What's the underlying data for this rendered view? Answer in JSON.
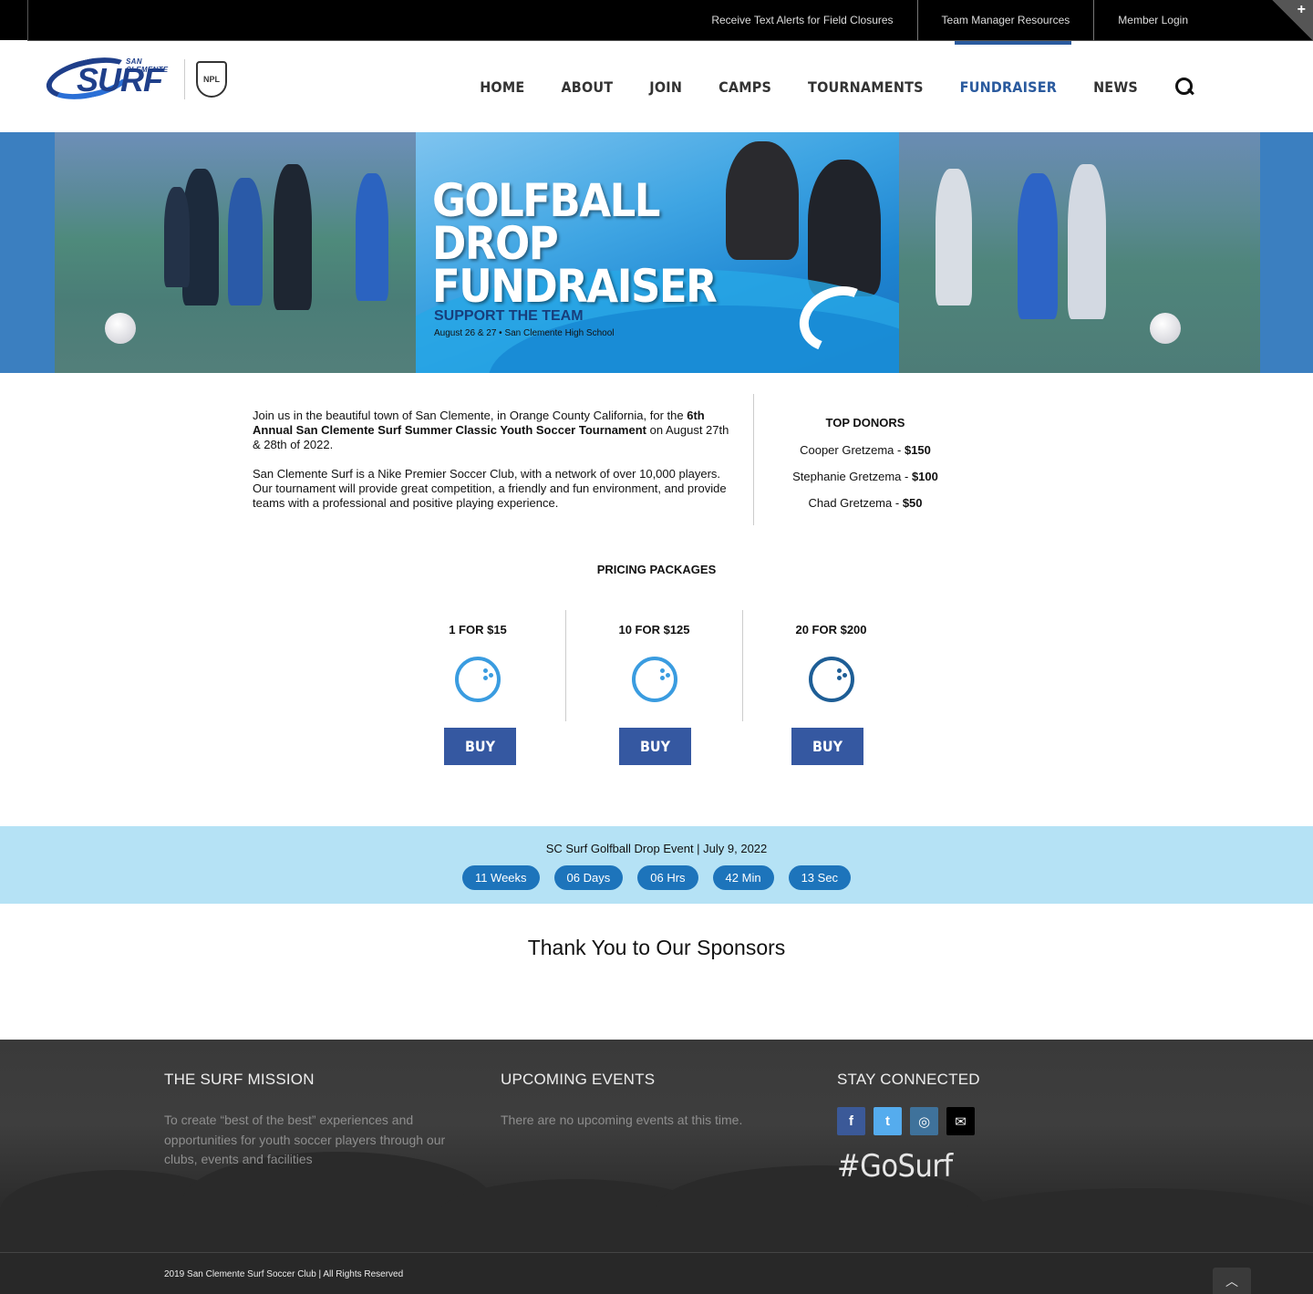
{
  "topbar": {
    "links": [
      "Receive Text Alerts for Field Closures",
      "Team Manager Resources",
      "Member Login"
    ],
    "toggle": "+"
  },
  "logo": {
    "small": "SAN CLEMENTE",
    "big": "SURF",
    "badge": "NPL"
  },
  "nav": {
    "items": [
      "HOME",
      "ABOUT",
      "JOIN",
      "CAMPS",
      "TOURNAMENTS",
      "FUNDRAISER",
      "NEWS"
    ],
    "active": "FUNDRAISER",
    "search_icon": "search-icon"
  },
  "hero": {
    "title_line1": "GOLFBALL",
    "title_line2": "DROP",
    "title_line3": "FUNDRAISER",
    "subtitle": "SUPPORT THE TEAM",
    "date": "August 26 & 27 • San Clemente High School"
  },
  "intro": {
    "p1_a": "Join us in the beautiful town of San Clemente, in Orange County California, for the ",
    "p1_bold": "6th Annual San Clemente Surf Summer Classic Youth Soccer Tournament",
    "p1_b": " on August 27th & 28th of 2022.",
    "p2": "San Clemente Surf is a Nike Premier Soccer Club, with a network of over 10,000 players. Our tournament will provide great competition, a friendly and fun environment, and provide teams with a professional and positive playing experience."
  },
  "donors": {
    "title": "TOP DONORS",
    "list": [
      {
        "name": "Cooper Gretzema - ",
        "amount": "$150"
      },
      {
        "name": "Stephanie Gretzema - ",
        "amount": "$100"
      },
      {
        "name": "Chad Gretzema - ",
        "amount": "$50"
      }
    ]
  },
  "pricing": {
    "title": "PRICING PACKAGES",
    "packages": [
      {
        "label": "1 FOR $15",
        "button": "BUY"
      },
      {
        "label": "10 FOR $125",
        "button": "BUY"
      },
      {
        "label": "20 FOR $200",
        "button": "BUY"
      }
    ]
  },
  "countdown": {
    "title": "SC Surf Golfball Drop Event | July 9, 2022",
    "units": [
      "11 Weeks",
      "06 Days",
      "06 Hrs",
      "42 Min",
      "13 Sec"
    ]
  },
  "sponsors": {
    "title": "Thank You to Our Sponsors"
  },
  "footer": {
    "mission_title": "THE SURF MISSION",
    "mission_text": "To create “best of the best” experiences and opportunities for youth soccer players through our clubs, events and facilities",
    "events_title": "UPCOMING EVENTS",
    "events_text": "There are no upcoming events at this time.",
    "connect_title": "STAY CONNECTED",
    "socials": [
      {
        "icon": "facebook-icon",
        "glyph": "f",
        "color": "#3b5998"
      },
      {
        "icon": "twitter-icon",
        "glyph": "t",
        "color": "#55acee"
      },
      {
        "icon": "instagram-icon",
        "glyph": "◎",
        "color": "#3f729b"
      },
      {
        "icon": "email-icon",
        "glyph": "✉",
        "color": "#000000"
      }
    ],
    "hashtag": "#GoSurf",
    "copyright": "2019 San Clemente Surf Soccer Club | All Rights Reserved",
    "to_top": "︿"
  },
  "colors": {
    "brand_blue": "#3558a1",
    "nav_active": "#2a5a9e",
    "countdown_bg": "#b5e2f5",
    "pill": "#1d74bb"
  }
}
